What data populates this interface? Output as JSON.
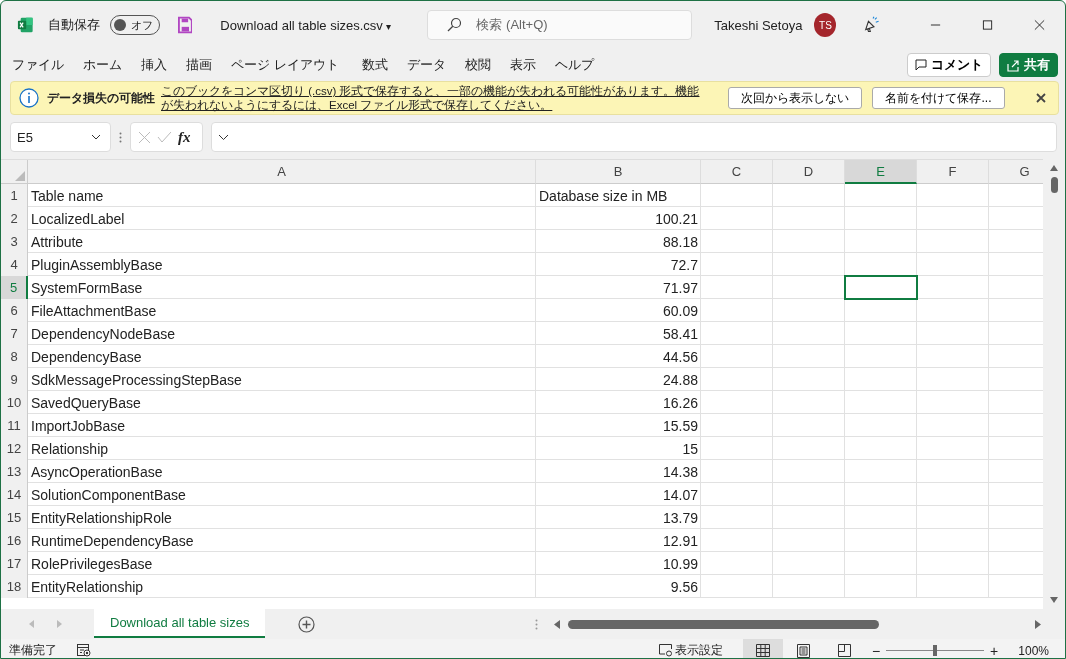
{
  "titlebar": {
    "autosave_label": "自動保存",
    "autosave": {
      "on": false,
      "label": "オフ"
    },
    "filename": "Download all table sizes.csv",
    "filename_caret": "▾",
    "search_placeholder": "検索 (Alt+Q)",
    "user_name": "Takeshi Setoya",
    "avatar_initials": "TS"
  },
  "ribbon_tabs": [
    "ファイル",
    "ホーム",
    "挿入",
    "描画",
    "ページ レイアウト",
    "数式",
    "データ",
    "校閲",
    "表示",
    "ヘルプ"
  ],
  "ribbon_buttons": {
    "comment": "コメント",
    "share": "共有"
  },
  "message_bar": {
    "title": "データ損失の可能性",
    "link": "このブックをコンマ区切り (.csv) 形式で保存すると、一部の機能が失われる可能性があります。機能が失われないようにするには、Excel ファイル形式で保存してください。",
    "buttons": [
      "次回から表示しない",
      "名前を付けて保存..."
    ]
  },
  "formula_bar": {
    "name_box": "E5",
    "function_button": "fx"
  },
  "columns": [
    {
      "label": "A",
      "selected": false
    },
    {
      "label": "B",
      "selected": false
    },
    {
      "label": "C",
      "selected": false
    },
    {
      "label": "D",
      "selected": false
    },
    {
      "label": "E",
      "selected": true
    },
    {
      "label": "F",
      "selected": false
    },
    {
      "label": "G",
      "selected": false
    }
  ],
  "rows": [
    {
      "number": "1",
      "kind": "header",
      "selected": false,
      "cells": [
        "Table name",
        "Database size in MB"
      ]
    },
    {
      "number": "2",
      "kind": "data",
      "selected": false,
      "cells": [
        "LocalizedLabel",
        "100.21"
      ]
    },
    {
      "number": "3",
      "kind": "data",
      "selected": false,
      "cells": [
        "Attribute",
        "88.18"
      ]
    },
    {
      "number": "4",
      "kind": "data",
      "selected": false,
      "cells": [
        "PluginAssemblyBase",
        "72.7"
      ]
    },
    {
      "number": "5",
      "kind": "data",
      "selected": true,
      "cells": [
        "SystemFormBase",
        "71.97"
      ]
    },
    {
      "number": "6",
      "kind": "data",
      "selected": false,
      "cells": [
        "FileAttachmentBase",
        "60.09"
      ]
    },
    {
      "number": "7",
      "kind": "data",
      "selected": false,
      "cells": [
        "DependencyNodeBase",
        "58.41"
      ]
    },
    {
      "number": "8",
      "kind": "data",
      "selected": false,
      "cells": [
        "DependencyBase",
        "44.56"
      ]
    },
    {
      "number": "9",
      "kind": "data",
      "selected": false,
      "cells": [
        "SdkMessageProcessingStepBase",
        "24.88"
      ]
    },
    {
      "number": "10",
      "kind": "data",
      "selected": false,
      "cells": [
        "SavedQueryBase",
        "16.26"
      ]
    },
    {
      "number": "11",
      "kind": "data",
      "selected": false,
      "cells": [
        "ImportJobBase",
        "15.59"
      ]
    },
    {
      "number": "12",
      "kind": "data",
      "selected": false,
      "cells": [
        "Relationship",
        "15"
      ]
    },
    {
      "number": "13",
      "kind": "data",
      "selected": false,
      "cells": [
        "AsyncOperationBase",
        "14.38"
      ]
    },
    {
      "number": "14",
      "kind": "data",
      "selected": false,
      "cells": [
        "SolutionComponentBase",
        "14.07"
      ]
    },
    {
      "number": "15",
      "kind": "data",
      "selected": false,
      "cells": [
        "EntityRelationshipRole",
        "13.79"
      ]
    },
    {
      "number": "16",
      "kind": "data",
      "selected": false,
      "cells": [
        "RuntimeDependencyBase",
        "12.91"
      ]
    },
    {
      "number": "17",
      "kind": "data",
      "selected": false,
      "cells": [
        "RolePrivilegesBase",
        "10.99"
      ]
    },
    {
      "number": "18",
      "kind": "data",
      "selected": false,
      "cells": [
        "EntityRelationship",
        "9.56"
      ]
    }
  ],
  "sheet_tabs": [
    {
      "label": "Download all table sizes",
      "selected": true
    }
  ],
  "status_bar": {
    "status": "準備完了",
    "display_settings": "表示設定",
    "views": [
      {
        "kind": "normal",
        "selected": true
      },
      {
        "kind": "page-layout",
        "selected": false
      },
      {
        "kind": "page-break",
        "selected": false
      }
    ],
    "zoom": {
      "level": 0.5,
      "label": "100%",
      "zoom_out": "−",
      "zoom_in": "+"
    }
  }
}
